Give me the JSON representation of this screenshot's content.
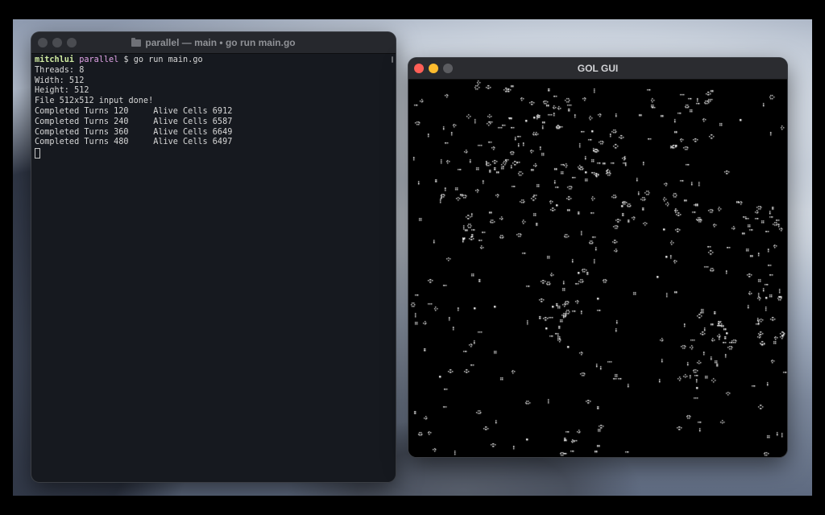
{
  "terminal": {
    "title": "parallel — main • go run main.go",
    "traffic_lights": [
      "close",
      "minimize",
      "zoom"
    ],
    "prompt": {
      "user": "mitchlui",
      "dir": "parallel",
      "symbol": "$",
      "command": "go run main.go"
    },
    "output_lines": [
      "Threads: 8",
      "Width: 512",
      "Height: 512",
      "File 512x512 input done!",
      "Completed Turns 120     Alive Cells 6912",
      "Completed Turns 240     Alive Cells 6587",
      "Completed Turns 360     Alive Cells 6649",
      "Completed Turns 480     Alive Cells 6497"
    ]
  },
  "gol_window": {
    "title": "GOL GUI",
    "traffic_lights": {
      "close": "#ff5f57",
      "minimize": "#febc2e",
      "zoom": "#5b5c60"
    },
    "board": {
      "width": 512,
      "height": 512,
      "cell_color": "#ffffff",
      "background": "#000000"
    }
  },
  "colors": {
    "terminal_bg": "#16191f",
    "prompt_user": "#cfeaa0",
    "prompt_dir": "#e0a3e6",
    "text": "#d7d7d7"
  }
}
